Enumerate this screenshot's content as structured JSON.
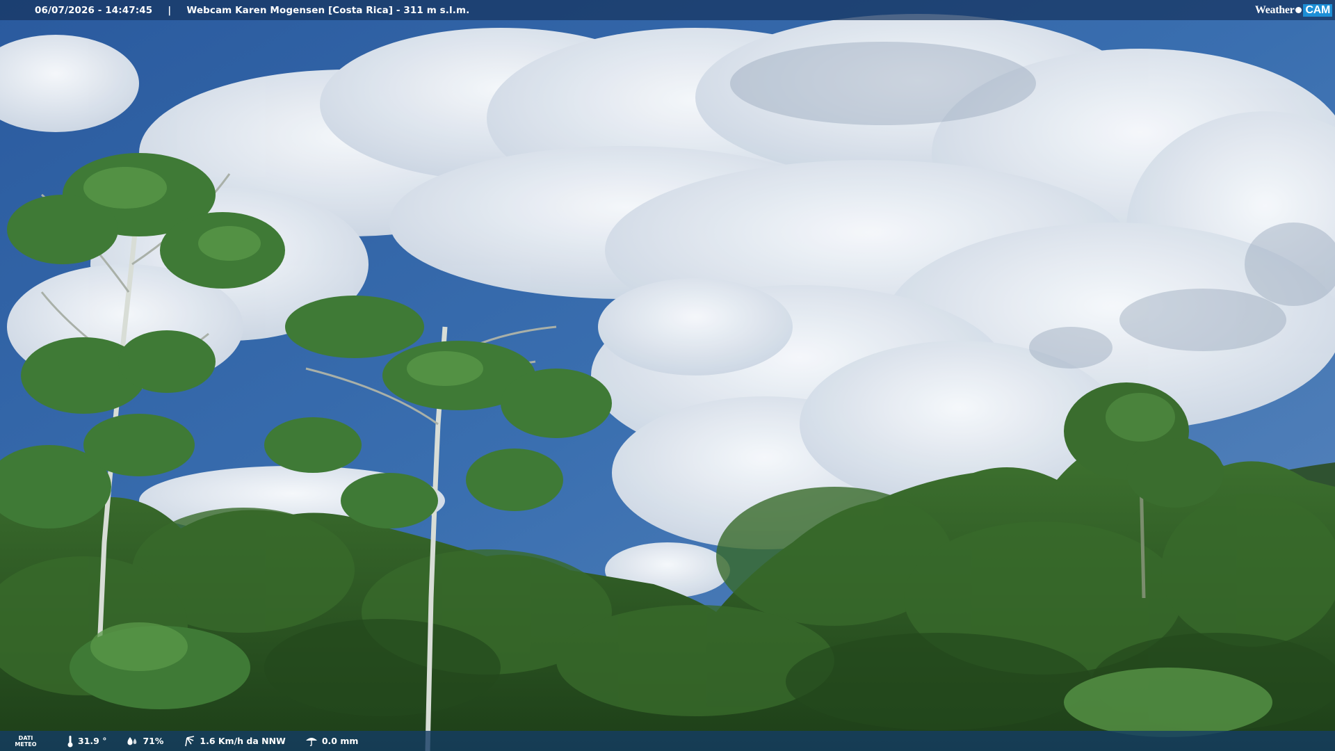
{
  "overlay": {
    "datetime": "06/07/2026 - 14:47:45",
    "separator": "|",
    "title": "Webcam Karen Mogensen [Costa Rica]  - 311 m s.l.m.",
    "brand_weather": "Weather",
    "brand_cam": "CAM"
  },
  "weather": {
    "label_line1": "DATI",
    "label_line2": "METEO",
    "temperature": "31.9 °",
    "humidity": "71%",
    "wind": "1.6 Km/h da NNW",
    "rain": "0.0 mm"
  },
  "icons": {
    "temperature": "thermometer-icon",
    "humidity": "humidity-icon",
    "wind": "wind-icon",
    "rain": "rain-icon"
  },
  "colors": {
    "sky": "#2f62a3",
    "cloud": "#eef1f4",
    "forest": "#2c5a22",
    "bar": "#163460",
    "brand_cam": "#1d8fd6"
  }
}
